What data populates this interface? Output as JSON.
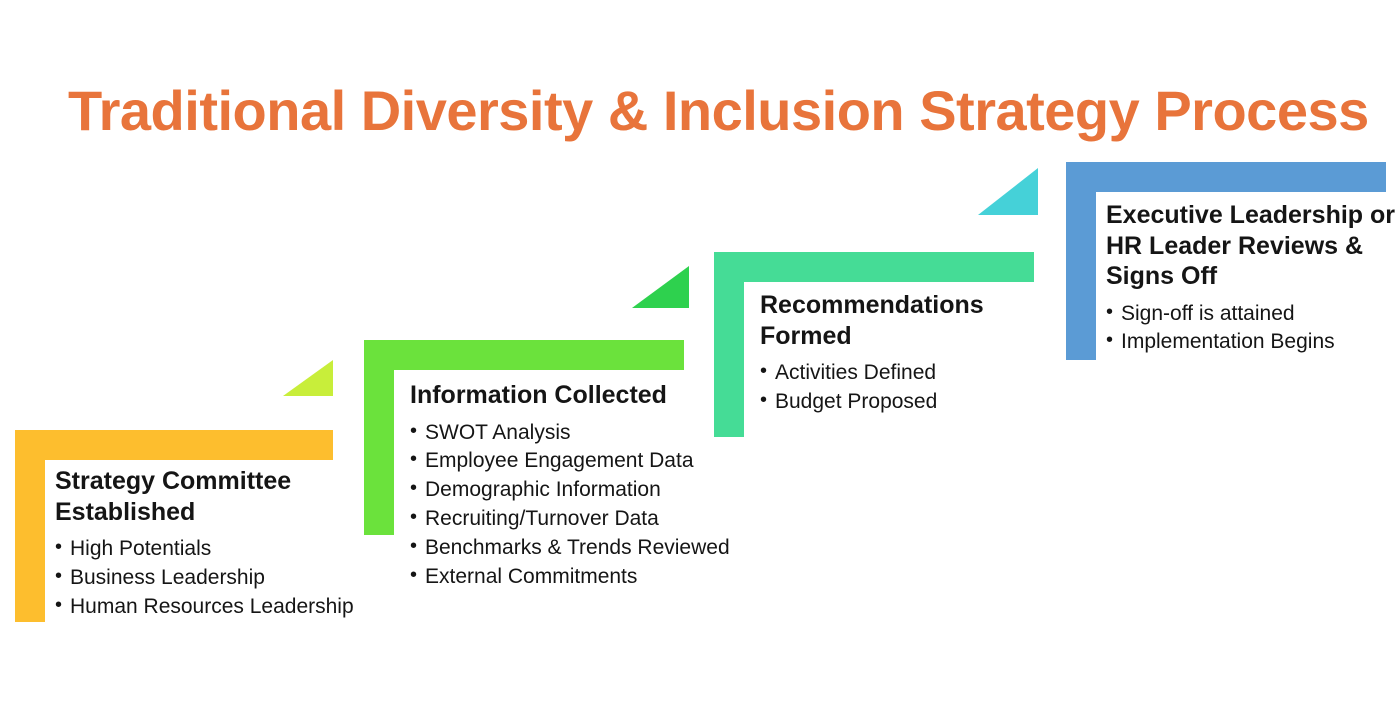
{
  "page": {
    "title": "Traditional Diversity & Inclusion Strategy Process",
    "title_color": "#E8743B",
    "background_color": "#FFFFFF"
  },
  "steps": [
    {
      "id": "strategy-committee-established",
      "order": 1,
      "title": "Strategy Committee Established",
      "color": "#FDBE2E",
      "bullets": [
        "High Potentials",
        "Business Leadership",
        "Human Resources Leadership"
      ]
    },
    {
      "id": "information-collected",
      "order": 2,
      "title": "Information Collected",
      "color": "#6BE23C",
      "bullets": [
        "SWOT Analysis",
        "Employee Engagement Data",
        "Demographic Information",
        "Recruiting/Turnover Data",
        "Benchmarks & Trends Reviewed",
        "External Commitments"
      ]
    },
    {
      "id": "recommendations-formed",
      "order": 3,
      "title": "Recommendations Formed",
      "color": "#45DC96",
      "bullets": [
        "Activities Defined",
        "Budget Proposed"
      ]
    },
    {
      "id": "executive-leadership-signs-off",
      "order": 4,
      "title": "Executive Leadership or HR Leader Reviews & Signs Off",
      "color": "#5B9BD5",
      "bullets": [
        "Sign-off is attained",
        "Implementation Begins"
      ]
    }
  ],
  "connectors": [
    {
      "id": "connector-step1-to-step2",
      "from": "strategy-committee-established",
      "to": "information-collected",
      "color": "#C8EE3A",
      "shape": "right-triangle"
    },
    {
      "id": "connector-step2-to-step3",
      "from": "information-collected",
      "to": "recommendations-formed",
      "color": "#2ED14E",
      "shape": "right-triangle"
    },
    {
      "id": "connector-step3-to-step4",
      "from": "recommendations-formed",
      "to": "executive-leadership-signs-off",
      "color": "#45D1D8",
      "shape": "right-triangle"
    }
  ]
}
